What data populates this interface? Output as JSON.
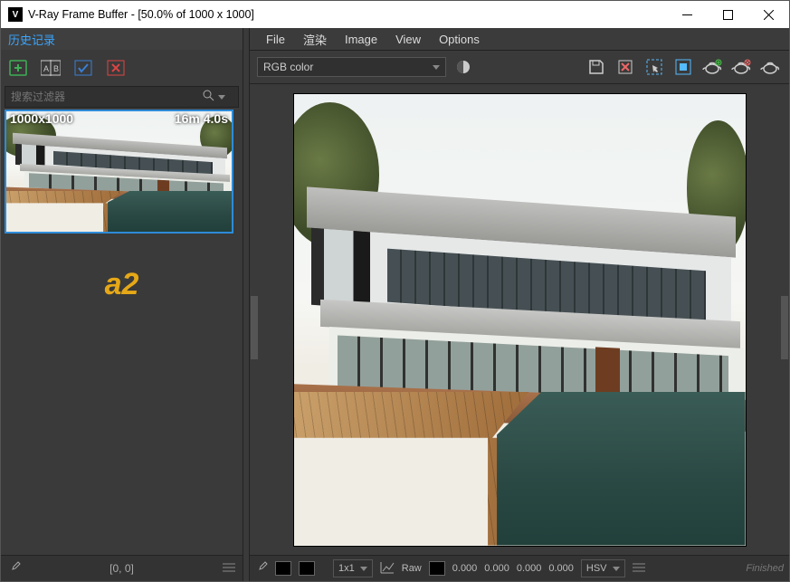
{
  "window": {
    "title": "V-Ray Frame Buffer - [50.0% of 1000 x 1000]"
  },
  "sidebar": {
    "heading": "历史记录",
    "search_placeholder": "搜索过滤器",
    "thumb": {
      "resolution": "1000x1000",
      "time": "16m 4.0s"
    },
    "label_a2": "a2",
    "footer_coords": "[0, 0]"
  },
  "menubar": {
    "file": "File",
    "render": "渲染",
    "image": "Image",
    "view": "View",
    "options": "Options"
  },
  "toolbar": {
    "channel_selector": "RGB color"
  },
  "statusbar": {
    "zoom": "1x1",
    "raw": "Raw",
    "r": "0.000",
    "g": "0.000",
    "b": "0.000",
    "a": "0.000",
    "mode": "HSV",
    "status": "Finished"
  }
}
